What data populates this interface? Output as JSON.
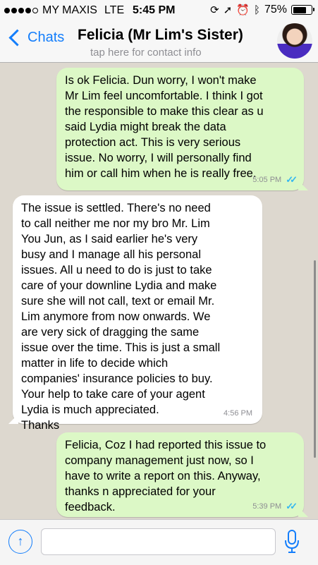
{
  "status_bar": {
    "carrier": "MY MAXIS",
    "network": "LTE",
    "time": "5:45 PM",
    "battery_percent": "75%",
    "battery_level": 0.75,
    "signal_bars_filled": 4,
    "icons": [
      "lock-rotation-icon",
      "location-arrow-icon",
      "alarm-icon",
      "bluetooth-icon",
      "battery-icon"
    ]
  },
  "nav": {
    "back_label": "Chats",
    "contact_name": "Felicia (Mr Lim's Sister)",
    "subtitle": "tap here for contact info"
  },
  "messages": [
    {
      "direction": "outgoing",
      "text": "Is ok Felicia. Dun worry, I won't make\nMr Lim feel uncomfortable. I think I got\nthe responsible to make this clear as u\nsaid Lydia might break the data\nprotection act. This is very serious\nissue. No worry, I will personally find\nhim or call him when he is really free.",
      "time": "5:05 PM",
      "read": true
    },
    {
      "direction": "incoming",
      "text": "The issue is settled. There's no need\nto call neither me nor my bro Mr. Lim\nYou Jun, as I said earlier he's very\nbusy and I manage all his personal\nissues. All u need to do is just to take\ncare of your downline Lydia and make\nsure she will not call, text or email Mr.\nLim anymore from now onwards. We\nare very sick of dragging the same\nissue over the time. This is just a small\nmatter in life to decide which\ncompanies' insurance policies to buy.\nYour help to take care of your agent\nLydia is much appreciated.\nThanks",
      "time": "4:56 PM"
    },
    {
      "direction": "outgoing",
      "text": "Felicia, Coz I had reported this issue to\ncompany management just now, so I\nhave to write a report on this. Anyway,\nthanks n appreciated for your\nfeedback.",
      "time": "5:39 PM",
      "read": true
    }
  ],
  "input": {
    "placeholder": "",
    "value": ""
  },
  "colors": {
    "accent": "#147efb",
    "outgoing_bubble": "#dcf8c6",
    "incoming_bubble": "#ffffff",
    "read_ticks": "#34b7f1",
    "chat_background": "#ddd8cf"
  }
}
